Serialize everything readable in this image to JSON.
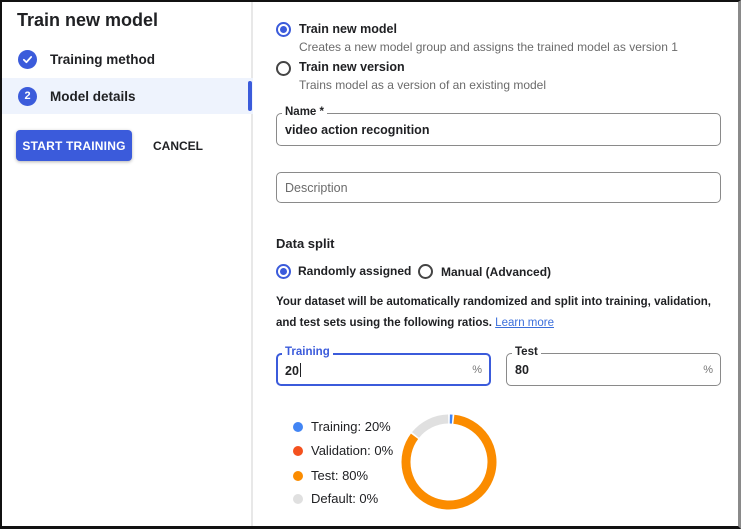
{
  "sidebar": {
    "title": "Train new model",
    "steps": [
      {
        "label": "Training method",
        "status": "completed",
        "icon": "check-icon"
      },
      {
        "label": "Model details",
        "status": "active",
        "number": "2"
      }
    ],
    "start_button": "START TRAINING",
    "cancel_button": "CANCEL"
  },
  "training_options": [
    {
      "title": "Train new model",
      "description": "Creates a new model group and assigns the trained model as version 1",
      "selected": true
    },
    {
      "title": "Train new version",
      "description": "Trains model as a version of an existing model",
      "selected": false
    }
  ],
  "name_field": {
    "label": "Name *",
    "value": "video action recognition"
  },
  "description_field": {
    "placeholder": "Description",
    "value": ""
  },
  "data_split": {
    "title": "Data split",
    "options": [
      {
        "label": "Randomly assigned",
        "selected": true
      },
      {
        "label": "Manual (Advanced)",
        "selected": false
      }
    ],
    "info_text": "Your dataset will be automatically randomized and split into training, validation, and test sets using the following ratios.",
    "learn_more": "Learn more",
    "training_field": {
      "label": "Training",
      "value": "20",
      "suffix": "%"
    },
    "test_field": {
      "label": "Test",
      "value": "80",
      "suffix": "%"
    }
  },
  "colors": {
    "accent": "#3b5bdb",
    "training": "#4285f4",
    "validation": "#f4511e",
    "test": "#fb8c00",
    "default": "#e0e0e0"
  },
  "chart_data": {
    "type": "pie",
    "variant": "donut",
    "title": "",
    "categories": [
      "Training",
      "Validation",
      "Test",
      "Default"
    ],
    "values": [
      20,
      0,
      80,
      0
    ],
    "legend": [
      {
        "label": "Training: 20%",
        "color": "#4285f4"
      },
      {
        "label": "Validation: 0%",
        "color": "#f4511e"
      },
      {
        "label": "Test: 80%",
        "color": "#fb8c00"
      },
      {
        "label": "Default: 0%",
        "color": "#e0e0e0"
      }
    ],
    "rendered_arcs_percent": [
      {
        "name": "Training",
        "color": "#4285f4",
        "percent": 1.5
      },
      {
        "name": "Test",
        "color": "#fb8c00",
        "percent": 84
      },
      {
        "name": "Default",
        "color": "#e0e0e0",
        "percent": 14.5
      }
    ],
    "legend_position": "left"
  }
}
